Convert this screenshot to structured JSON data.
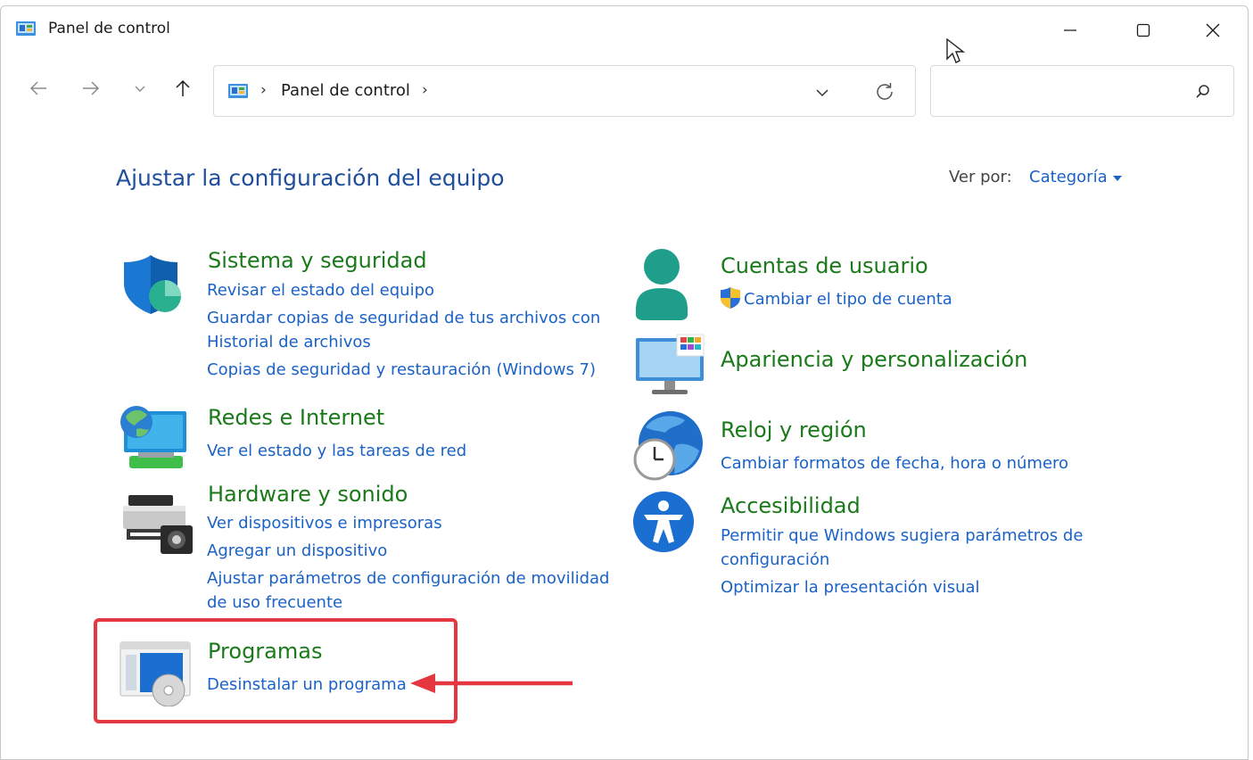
{
  "window": {
    "title": "Panel de control",
    "controls": {
      "minimize": "minimize-icon",
      "maximize": "maximize-icon",
      "close": "close-icon"
    }
  },
  "address": {
    "sep": "›",
    "path": "Panel de control",
    "sep_end": "›",
    "search_placeholder": ""
  },
  "main": {
    "heading": "Ajustar la configuración del equipo",
    "view_by_label": "Ver por:",
    "view_by_value": "Categoría"
  },
  "categories": {
    "system": {
      "title": "Sistema y seguridad",
      "links": [
        "Revisar el estado del equipo",
        "Guardar copias de seguridad de tus archivos con",
        "Historial de archivos",
        "Copias de seguridad y restauración (Windows 7)"
      ]
    },
    "network": {
      "title": "Redes e Internet",
      "links": [
        "Ver el estado y las tareas de red"
      ]
    },
    "hardware": {
      "title": "Hardware y sonido",
      "links": [
        "Ver dispositivos e impresoras",
        "Agregar un dispositivo",
        "Ajustar parámetros de configuración de movilidad",
        "de uso frecuente"
      ]
    },
    "programs": {
      "title": "Programas",
      "links": [
        "Desinstalar un programa"
      ]
    },
    "accounts": {
      "title": "Cuentas de usuario",
      "links": [
        "Cambiar el tipo de cuenta"
      ]
    },
    "appearance": {
      "title": "Apariencia y personalización"
    },
    "clock": {
      "title": "Reloj y región",
      "links": [
        "Cambiar formatos de fecha, hora o número"
      ]
    },
    "accessibility": {
      "title": "Accesibilidad",
      "links": [
        "Permitir que Windows sugiera parámetros de",
        "configuración",
        "Optimizar la presentación visual"
      ]
    }
  },
  "colors": {
    "heading": "#1e4e9c",
    "category_title": "#1a7a1a",
    "link": "#1a62c7",
    "highlight": "#e5373f"
  }
}
